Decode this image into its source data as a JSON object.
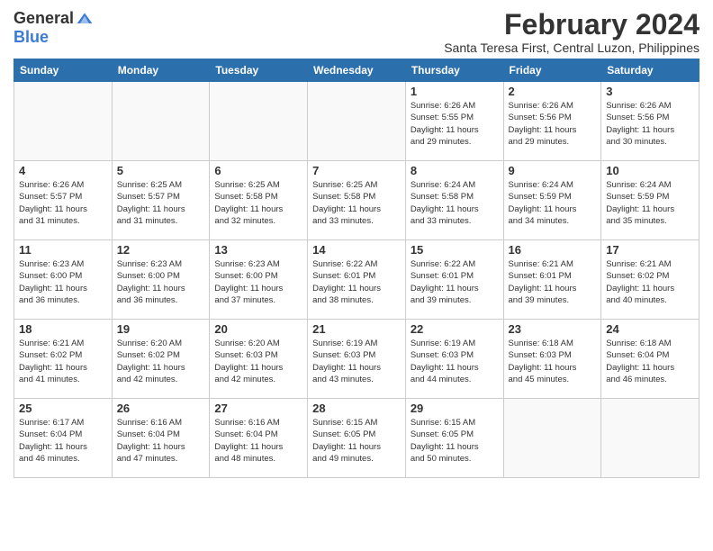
{
  "logo": {
    "general": "General",
    "blue": "Blue"
  },
  "title": {
    "month_year": "February 2024",
    "location": "Santa Teresa First, Central Luzon, Philippines"
  },
  "headers": [
    "Sunday",
    "Monday",
    "Tuesday",
    "Wednesday",
    "Thursday",
    "Friday",
    "Saturday"
  ],
  "weeks": [
    [
      {
        "day": "",
        "info": ""
      },
      {
        "day": "",
        "info": ""
      },
      {
        "day": "",
        "info": ""
      },
      {
        "day": "",
        "info": ""
      },
      {
        "day": "1",
        "info": "Sunrise: 6:26 AM\nSunset: 5:55 PM\nDaylight: 11 hours\nand 29 minutes."
      },
      {
        "day": "2",
        "info": "Sunrise: 6:26 AM\nSunset: 5:56 PM\nDaylight: 11 hours\nand 29 minutes."
      },
      {
        "day": "3",
        "info": "Sunrise: 6:26 AM\nSunset: 5:56 PM\nDaylight: 11 hours\nand 30 minutes."
      }
    ],
    [
      {
        "day": "4",
        "info": "Sunrise: 6:26 AM\nSunset: 5:57 PM\nDaylight: 11 hours\nand 31 minutes."
      },
      {
        "day": "5",
        "info": "Sunrise: 6:25 AM\nSunset: 5:57 PM\nDaylight: 11 hours\nand 31 minutes."
      },
      {
        "day": "6",
        "info": "Sunrise: 6:25 AM\nSunset: 5:58 PM\nDaylight: 11 hours\nand 32 minutes."
      },
      {
        "day": "7",
        "info": "Sunrise: 6:25 AM\nSunset: 5:58 PM\nDaylight: 11 hours\nand 33 minutes."
      },
      {
        "day": "8",
        "info": "Sunrise: 6:24 AM\nSunset: 5:58 PM\nDaylight: 11 hours\nand 33 minutes."
      },
      {
        "day": "9",
        "info": "Sunrise: 6:24 AM\nSunset: 5:59 PM\nDaylight: 11 hours\nand 34 minutes."
      },
      {
        "day": "10",
        "info": "Sunrise: 6:24 AM\nSunset: 5:59 PM\nDaylight: 11 hours\nand 35 minutes."
      }
    ],
    [
      {
        "day": "11",
        "info": "Sunrise: 6:23 AM\nSunset: 6:00 PM\nDaylight: 11 hours\nand 36 minutes."
      },
      {
        "day": "12",
        "info": "Sunrise: 6:23 AM\nSunset: 6:00 PM\nDaylight: 11 hours\nand 36 minutes."
      },
      {
        "day": "13",
        "info": "Sunrise: 6:23 AM\nSunset: 6:00 PM\nDaylight: 11 hours\nand 37 minutes."
      },
      {
        "day": "14",
        "info": "Sunrise: 6:22 AM\nSunset: 6:01 PM\nDaylight: 11 hours\nand 38 minutes."
      },
      {
        "day": "15",
        "info": "Sunrise: 6:22 AM\nSunset: 6:01 PM\nDaylight: 11 hours\nand 39 minutes."
      },
      {
        "day": "16",
        "info": "Sunrise: 6:21 AM\nSunset: 6:01 PM\nDaylight: 11 hours\nand 39 minutes."
      },
      {
        "day": "17",
        "info": "Sunrise: 6:21 AM\nSunset: 6:02 PM\nDaylight: 11 hours\nand 40 minutes."
      }
    ],
    [
      {
        "day": "18",
        "info": "Sunrise: 6:21 AM\nSunset: 6:02 PM\nDaylight: 11 hours\nand 41 minutes."
      },
      {
        "day": "19",
        "info": "Sunrise: 6:20 AM\nSunset: 6:02 PM\nDaylight: 11 hours\nand 42 minutes."
      },
      {
        "day": "20",
        "info": "Sunrise: 6:20 AM\nSunset: 6:03 PM\nDaylight: 11 hours\nand 42 minutes."
      },
      {
        "day": "21",
        "info": "Sunrise: 6:19 AM\nSunset: 6:03 PM\nDaylight: 11 hours\nand 43 minutes."
      },
      {
        "day": "22",
        "info": "Sunrise: 6:19 AM\nSunset: 6:03 PM\nDaylight: 11 hours\nand 44 minutes."
      },
      {
        "day": "23",
        "info": "Sunrise: 6:18 AM\nSunset: 6:03 PM\nDaylight: 11 hours\nand 45 minutes."
      },
      {
        "day": "24",
        "info": "Sunrise: 6:18 AM\nSunset: 6:04 PM\nDaylight: 11 hours\nand 46 minutes."
      }
    ],
    [
      {
        "day": "25",
        "info": "Sunrise: 6:17 AM\nSunset: 6:04 PM\nDaylight: 11 hours\nand 46 minutes."
      },
      {
        "day": "26",
        "info": "Sunrise: 6:16 AM\nSunset: 6:04 PM\nDaylight: 11 hours\nand 47 minutes."
      },
      {
        "day": "27",
        "info": "Sunrise: 6:16 AM\nSunset: 6:04 PM\nDaylight: 11 hours\nand 48 minutes."
      },
      {
        "day": "28",
        "info": "Sunrise: 6:15 AM\nSunset: 6:05 PM\nDaylight: 11 hours\nand 49 minutes."
      },
      {
        "day": "29",
        "info": "Sunrise: 6:15 AM\nSunset: 6:05 PM\nDaylight: 11 hours\nand 50 minutes."
      },
      {
        "day": "",
        "info": ""
      },
      {
        "day": "",
        "info": ""
      }
    ]
  ]
}
